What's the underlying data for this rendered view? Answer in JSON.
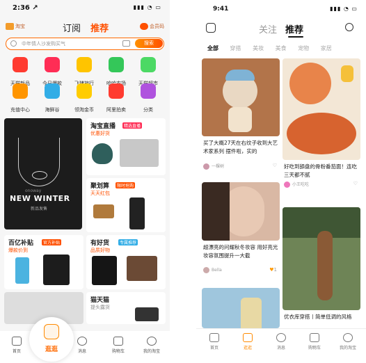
{
  "left": {
    "status": {
      "time": "2:36 ↗",
      "system": "▮▮▮ ◔ ▭"
    },
    "topnav": {
      "brand_left": "淘宝",
      "tab_follow": "订阅",
      "tab_recommend": "推荐",
      "brand_right": "会员码"
    },
    "search": {
      "placeholder": "中年情人沙发购买气",
      "button": "搜索"
    },
    "icons": [
      {
        "label": "天猫新品",
        "color": "#ff3b30"
      },
      {
        "label": "今日爆款",
        "color": "#ff2d55"
      },
      {
        "label": "飞猪旅行",
        "color": "#ffc400"
      },
      {
        "label": "哈哈农场",
        "color": "#34c759"
      },
      {
        "label": "天猫超市",
        "color": "#4cd964"
      },
      {
        "label": "充值中心",
        "color": "#ff9500"
      },
      {
        "label": "海鲜谷",
        "color": "#32ade6"
      },
      {
        "label": "领淘金币",
        "color": "#ffcc00"
      },
      {
        "label": "阿里拍卖",
        "color": "#ff3b30"
      },
      {
        "label": "分类",
        "color": "#af52de"
      }
    ],
    "feed": {
      "big": {
        "brand": "onoway",
        "headline": "NEW WINTER",
        "sub": "新品发售"
      },
      "live": {
        "title": "淘宝直播",
        "tag": "精选直播",
        "sub": "优惠好货"
      },
      "deal": {
        "title": "聚划算",
        "tag": "限时抢购",
        "sub": "天天红包"
      },
      "coupon": {
        "title": "百亿补贴",
        "tag": "官方补贴",
        "sub": "爆款价到"
      },
      "good": {
        "title": "有好货",
        "tag": "专属推荐",
        "sub": "品质好物"
      },
      "shop": {
        "title": "猫天猫",
        "sub": "提头露货"
      }
    },
    "bottom": {
      "home": "首页",
      "stroll": "逛逛",
      "msg": "消息",
      "cart": "购物车",
      "mine": "我的淘宝"
    }
  },
  "right": {
    "status": {
      "time": "9:41",
      "system": "▮▮▮ ◔ ▭"
    },
    "topnav": {
      "follow": "关注",
      "recommend": "推荐"
    },
    "categories": [
      "全部",
      "穿搭",
      "美妆",
      "美食",
      "宠物",
      "家居"
    ],
    "cards": [
      {
        "caption": "买了大概27天在右纹子收到大艺术家系列 摆件啦，实的",
        "user": "一棵树",
        "likes": ""
      },
      {
        "caption": "好吃到舔盘的骨粉番茄面！连吃三天都不腻",
        "user": "小王吃吃",
        "likes": ""
      },
      {
        "caption": "超漂亮的问耀秋冬妆容 用好亮光妆容氛围提升一大截",
        "user": "Bella",
        "likes": "1"
      },
      {
        "caption": "优衣库穿搭丨简单低调的风格",
        "user": "",
        "likes": ""
      }
    ],
    "bottom": {
      "home": "首页",
      "stroll": "逛逛",
      "msg": "消息",
      "cart": "购物车",
      "mine": "我的淘宝"
    }
  }
}
